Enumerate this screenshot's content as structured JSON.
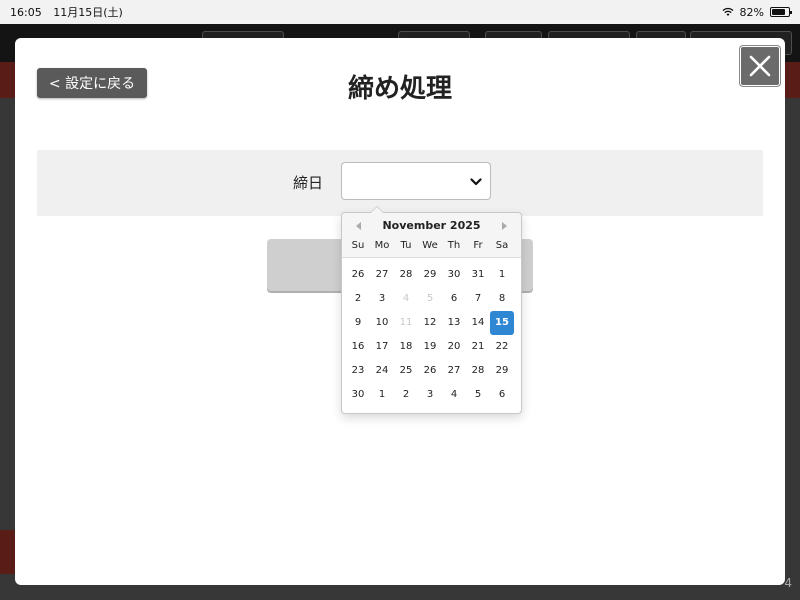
{
  "status_bar": {
    "time": "16:05",
    "date": "11月15日(土)",
    "battery": "82%",
    "battery_level": 0.82
  },
  "modal": {
    "back_label": "< 設定に戻る",
    "title": "締め処理",
    "close_icon": "close-icon"
  },
  "form": {
    "label": "締日",
    "select_value": ""
  },
  "datepicker": {
    "month_label": "November 2025",
    "days_of_week": [
      "Su",
      "Mo",
      "Tu",
      "We",
      "Th",
      "Fr",
      "Sa"
    ],
    "weeks": [
      [
        "26",
        "27",
        "28",
        "29",
        "30",
        "31",
        "1"
      ],
      [
        "2",
        "3",
        "4",
        "5",
        "6",
        "7",
        "8"
      ],
      [
        "9",
        "10",
        "11",
        "12",
        "13",
        "14",
        "15"
      ],
      [
        "16",
        "17",
        "18",
        "19",
        "20",
        "21",
        "22"
      ],
      [
        "23",
        "24",
        "25",
        "26",
        "27",
        "28",
        "29"
      ],
      [
        "30",
        "1",
        "2",
        "3",
        "4",
        "5",
        "6"
      ]
    ],
    "disabled_days": [
      "4",
      "5",
      "11"
    ],
    "selected_day": "15",
    "selected_color": "#2f86d2"
  },
  "corner_text": "4"
}
